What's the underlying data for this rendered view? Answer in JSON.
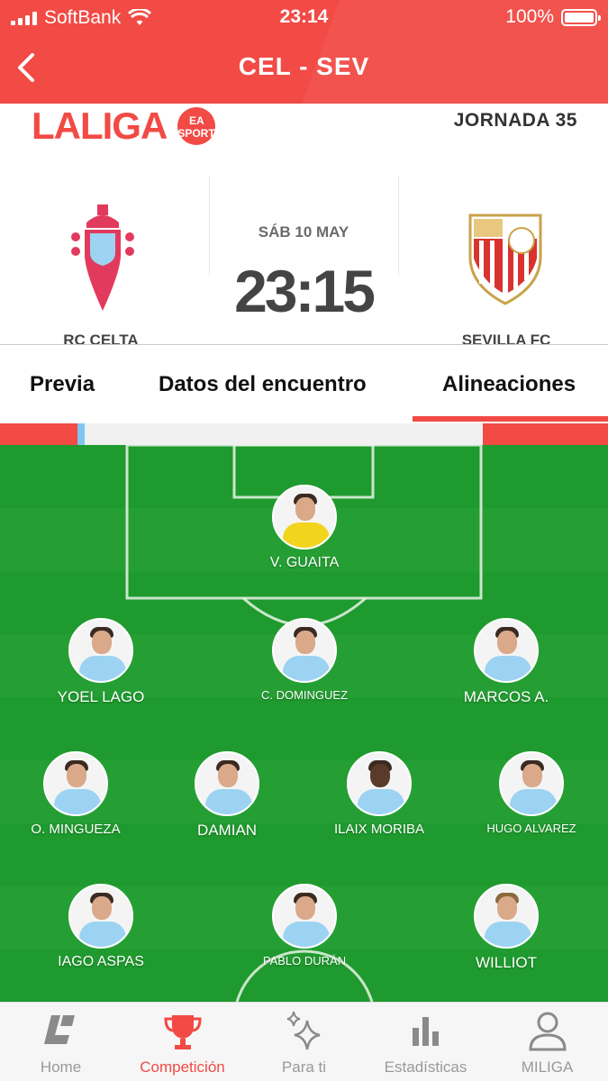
{
  "status_bar": {
    "carrier": "SoftBank",
    "time": "23:14",
    "battery": "100%"
  },
  "header": {
    "title": "CEL - SEV",
    "back_icon": "chevron-left-icon"
  },
  "match": {
    "league": "LALIGA",
    "league_badge": "EA SPORTS",
    "round": "JORNADA 35",
    "date": "SÁB 10 MAY",
    "kickoff": "23:15",
    "home_team": "RC CELTA",
    "away_team": "SEVILLA FC"
  },
  "tabs": [
    {
      "label": "Previa",
      "active": false
    },
    {
      "label": "Datos del encuentro",
      "active": false
    },
    {
      "label": "Alineaciones",
      "active": true
    }
  ],
  "lineup": {
    "goalkeeper": {
      "name": "V. GUAITA"
    },
    "row1": [
      {
        "name": "YOEL LAGO"
      },
      {
        "name": "C. DOMINGUEZ"
      },
      {
        "name": "MARCOS A."
      }
    ],
    "row2": [
      {
        "name": "O. MINGUEZA"
      },
      {
        "name": "DAMIAN"
      },
      {
        "name": "ILAIX MORIBA"
      },
      {
        "name": "HUGO ALVAREZ"
      }
    ],
    "row3": [
      {
        "name": "IAGO ASPAS"
      },
      {
        "name": "PABLO DURÁN"
      },
      {
        "name": "WILLIOT"
      }
    ]
  },
  "bottom_nav": [
    {
      "label": "Home",
      "icon": "laliga-logo-icon",
      "active": false
    },
    {
      "label": "Competición",
      "icon": "trophy-icon",
      "active": true
    },
    {
      "label": "Para ti",
      "icon": "sparkles-icon",
      "active": false
    },
    {
      "label": "Estadísticas",
      "icon": "bar-chart-icon",
      "active": false
    },
    {
      "label": "MILIGA",
      "icon": "user-icon",
      "active": false
    }
  ],
  "colors": {
    "accent": "#f24a45",
    "pitch": "#1f9a2e",
    "nav_inactive": "#999999"
  }
}
